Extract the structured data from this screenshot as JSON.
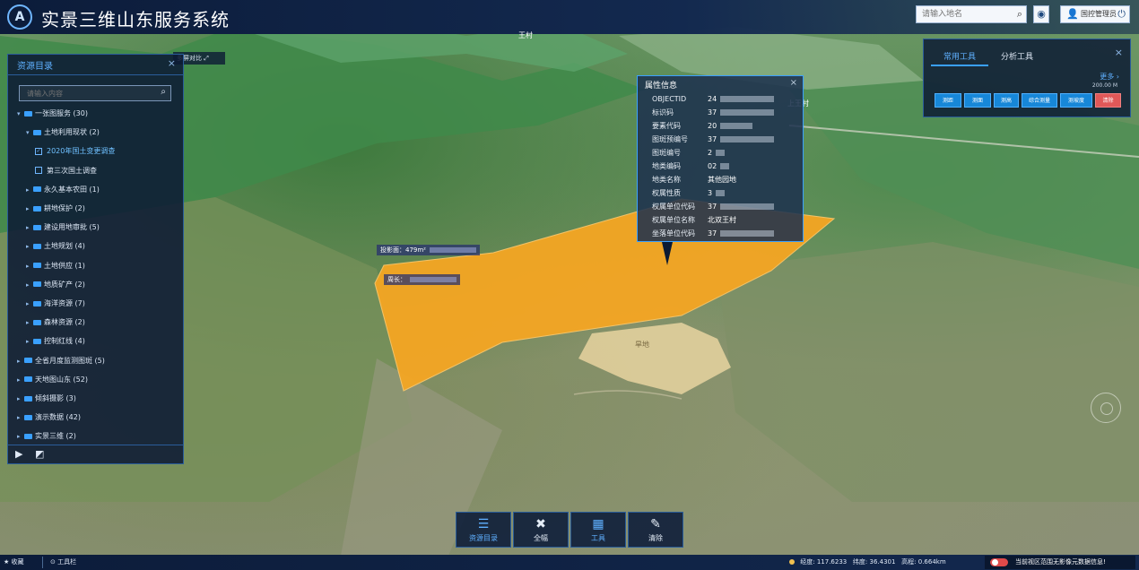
{
  "app": {
    "title": "实景三维山东服务系统",
    "logo_letter": "A"
  },
  "header": {
    "search_placeholder": "请输入地名",
    "user_label": "国控管理员"
  },
  "map_controls": {
    "mini_label": "多屏对比"
  },
  "resource_panel": {
    "title": "资源目录",
    "search_placeholder": "请输入内容",
    "tree": [
      {
        "label": "一张图服务",
        "count": "(30)",
        "level": 0,
        "expanded": true
      },
      {
        "label": "土地利用现状",
        "count": "(2)",
        "level": 1,
        "expanded": true
      },
      {
        "label": "2020年国土变更调查",
        "count": "",
        "level": 2,
        "checked": true
      },
      {
        "label": "第三次国土调查",
        "count": "",
        "level": 2,
        "checked": false
      },
      {
        "label": "永久基本农田",
        "count": "(1)",
        "level": 1
      },
      {
        "label": "耕地保护",
        "count": "(2)",
        "level": 1
      },
      {
        "label": "建设用地审批",
        "count": "(5)",
        "level": 1
      },
      {
        "label": "土地规划",
        "count": "(4)",
        "level": 1
      },
      {
        "label": "土地供应",
        "count": "(1)",
        "level": 1
      },
      {
        "label": "地质矿产",
        "count": "(2)",
        "level": 1
      },
      {
        "label": "海洋资源",
        "count": "(7)",
        "level": 1
      },
      {
        "label": "森林资源",
        "count": "(2)",
        "level": 1
      },
      {
        "label": "控制红线",
        "count": "(4)",
        "level": 1
      },
      {
        "label": "全省月度监测图斑",
        "count": "(5)",
        "level": 0
      },
      {
        "label": "天地图山东",
        "count": "(52)",
        "level": 0
      },
      {
        "label": "倾斜摄影",
        "count": "(3)",
        "level": 0
      },
      {
        "label": "演示数据",
        "count": "(42)",
        "level": 0
      },
      {
        "label": "实景三维",
        "count": "(2)",
        "level": 0
      }
    ]
  },
  "tools_panel": {
    "tabs": [
      "常用工具",
      "分析工具"
    ],
    "more": "更多",
    "scale_text": "200.00 M",
    "buttons": [
      "测距",
      "测面",
      "测高",
      "综合测量",
      "测坡度",
      "清除"
    ]
  },
  "popup": {
    "title": "属性信息",
    "rows": [
      {
        "key": "OBJECTID",
        "value": "24"
      },
      {
        "key": "标识码",
        "value": "37"
      },
      {
        "key": "要素代码",
        "value": "20"
      },
      {
        "key": "图斑预编号",
        "value": "37"
      },
      {
        "key": "图斑编号",
        "value": "2"
      },
      {
        "key": "地类编码",
        "value": "02"
      },
      {
        "key": "地类名称",
        "value": "其他园地"
      },
      {
        "key": "权属性质",
        "value": "3"
      },
      {
        "key": "权属单位代码",
        "value": "37"
      },
      {
        "key": "权属单位名称",
        "value": "北双王村"
      },
      {
        "key": "坐落单位代码",
        "value": "37"
      }
    ]
  },
  "map_labels": {
    "area_label": "投影面：479m²",
    "perim_label": "周长：",
    "village_top": "王村",
    "village_right": "上王村",
    "bare_label": "旱地"
  },
  "bottom_toolbar": [
    {
      "label": "资源目录",
      "icon": "layers-icon",
      "active": true
    },
    {
      "label": "全幅",
      "icon": "full-extent-icon",
      "active": false
    },
    {
      "label": "工具",
      "icon": "toolbox-icon",
      "active": true
    },
    {
      "label": "清除",
      "icon": "eraser-icon",
      "active": false
    }
  ],
  "status_bar": {
    "favorites": "收藏",
    "toolbar": "工具栏",
    "longitude_label": "经度:",
    "longitude": "117.6233",
    "latitude_label": "纬度:",
    "latitude": "36.4301",
    "altitude_label": "高程:",
    "altitude": "0.664km",
    "notice": "当前视区范围无影像元数据信息!"
  },
  "colors": {
    "accent": "#3aa0ff",
    "polygon": "#f5a623",
    "danger": "#e05858",
    "header": "#0c1c3a"
  }
}
